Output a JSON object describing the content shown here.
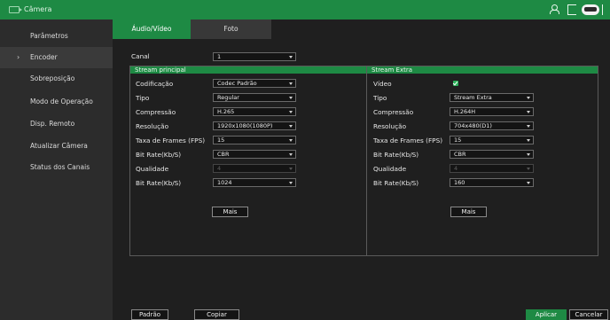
{
  "app": {
    "title": "Câmera"
  },
  "sidebar": {
    "items": [
      {
        "label": "Parâmetros"
      },
      {
        "label": "Encoder",
        "arrow": "›"
      },
      {
        "label": "Sobreposição"
      },
      {
        "label": "Modo de Operação"
      },
      {
        "label": "Disp. Remoto"
      },
      {
        "label": "Atualizar Câmera"
      },
      {
        "label": "Status dos Canais"
      }
    ]
  },
  "tabs": [
    {
      "label": "Áudio/Vídeo"
    },
    {
      "label": "Foto"
    }
  ],
  "channel": {
    "label": "Canal",
    "value": "1"
  },
  "main_stream": {
    "title": "Stream principal",
    "rows": [
      {
        "label": "Codificação",
        "value": "Codec Padrão"
      },
      {
        "label": "Tipo",
        "value": "Regular"
      },
      {
        "label": "Compressão",
        "value": "H.265"
      },
      {
        "label": "Resolução",
        "value": "1920x1080(1080P)"
      },
      {
        "label": "Taxa de Frames (FPS)",
        "value": "15"
      },
      {
        "label": "Bit Rate(Kb/S)",
        "value": "CBR"
      },
      {
        "label": "Qualidade",
        "value": "4"
      },
      {
        "label": "Bit Rate(Kb/S)",
        "value": "1024"
      }
    ],
    "more_label": "Mais"
  },
  "extra_stream": {
    "title": "Stream Extra",
    "video_label": "Vídeo",
    "video_checked": true,
    "rows": [
      {
        "label": "Tipo",
        "value": "Stream Extra"
      },
      {
        "label": "Compressão",
        "value": "H.264H"
      },
      {
        "label": "Resolução",
        "value": "704x480(D1)"
      },
      {
        "label": "Taxa de Frames (FPS)",
        "value": "15"
      },
      {
        "label": "Bit Rate(Kb/S)",
        "value": "CBR"
      },
      {
        "label": "Qualidade",
        "value": "4"
      },
      {
        "label": "Bit Rate(Kb/S)",
        "value": "160"
      }
    ],
    "more_label": "Mais"
  },
  "footer": {
    "default_label": "Padrão",
    "copy_label": "Copiar",
    "apply_label": "Aplicar",
    "cancel_label": "Cancelar"
  },
  "colors": {
    "accent": "#1e8a44",
    "sidebar_bg": "#2c2c2c",
    "content_bg": "#1f1f1f"
  }
}
